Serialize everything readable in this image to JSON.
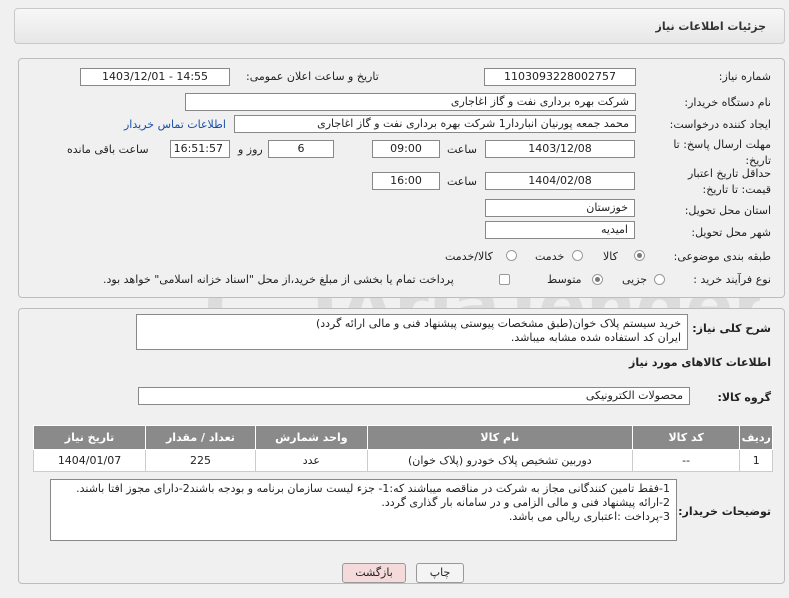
{
  "header": {
    "title": "جزئیات اطلاعات نیاز"
  },
  "form": {
    "need_number_label": "شماره نیاز:",
    "need_number": "1103093228002757",
    "announce_label": "تاریخ و ساعت اعلان عمومی:",
    "announce_value": "1403/12/01 - 14:55",
    "buyer_org_label": "نام دستگاه خریدار:",
    "buyer_org": "شرکت بهره برداری نفت و گاز اغاجاری",
    "requester_label": "ایجاد کننده درخواست:",
    "requester": "محمد جمعه پورنیان انباردار1 شرکت بهره برداری نفت و گاز اغاجاری",
    "contact_link": "اطلاعات تماس خریدار",
    "deadline_label": "مهلت ارسال پاسخ: تا تاریخ:",
    "deadline_date": "1403/12/08",
    "time_label": "ساعت",
    "deadline_time": "09:00",
    "days_value": "6",
    "days_label": "روز و",
    "remaining_time": "16:51:57",
    "remaining_label": "ساعت باقی مانده",
    "validity_label": "حداقل تاریخ اعتبار قیمت: تا تاریخ:",
    "validity_date": "1404/02/08",
    "validity_time_label": "ساعت",
    "validity_time": "16:00",
    "province_label": "استان محل تحویل:",
    "province": "خوزستان",
    "city_label": "شهر محل تحویل:",
    "city": "امیدیه",
    "category_label": "طبقه بندی موضوعی:",
    "category_options": [
      "کالا",
      "خدمت",
      "کالا/خدمت"
    ],
    "process_label": "نوع فرآیند خرید :",
    "process_options": [
      "جزیی",
      "متوسط"
    ],
    "payment_note": "پرداخت تمام یا بخشی از مبلغ خرید،از محل \"اسناد خزانه اسلامی\" خواهد بود."
  },
  "description": {
    "label": "شرح کلی نیاز:",
    "line1": "خرید سیستم پلاک خوان(طبق مشخصات پیوستی پیشنهاد فنی و مالی ارائه گردد)",
    "line2": "ایران کد استفاده شده مشابه میباشد."
  },
  "goods": {
    "section_title": "اطلاعات کالاهای مورد نیاز",
    "group_label": "گروه کالا:",
    "group_value": "محصولات الکترونیکی",
    "columns": [
      "ردیف",
      "کد کالا",
      "نام کالا",
      "واحد شمارش",
      "تعداد / مقدار",
      "تاریخ نیاز"
    ],
    "rows": [
      [
        "1",
        "--",
        "دوربین تشخیص پلاک خودرو (پلاک خوان)",
        "عدد",
        "225",
        "1404/01/07"
      ]
    ]
  },
  "buyer_notes": {
    "label": "توضیحات خریدار:",
    "lines": [
      "1-فقط تامین کنندگانی مجاز به شرکت در مناقصه میباشند که:1- جزء لیست سازمان برنامه و بودجه باشند2-دارای مجوز افتا باشند.",
      "2-ارائه پیشنهاد فنی و مالی الزامی و در سامانه بار گذاری گردد.",
      "3-پرداخت :اعتباری ریالی  می باشد."
    ]
  },
  "buttons": {
    "print": "چاپ",
    "back": "بازگشت"
  },
  "watermark": {
    "text": "AriaTender.neT"
  },
  "colors": {
    "link": "#1a4ea8",
    "table_header": "#8a8a8a",
    "back_button": "#f4dada"
  }
}
